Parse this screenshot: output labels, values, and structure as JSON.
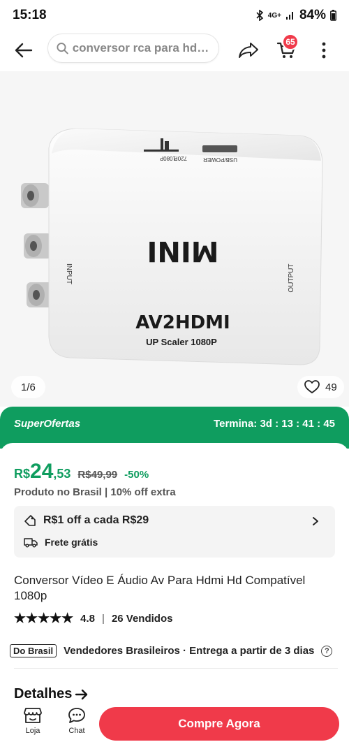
{
  "status": {
    "time": "15:18",
    "network": "4G+",
    "battery": "84%"
  },
  "header": {
    "search_placeholder": "conversor rca para hdmi...",
    "cart_count": "65",
    "icons": [
      "back-arrow-icon",
      "search-icon",
      "share-icon",
      "cart-icon",
      "more-vertical-icon"
    ]
  },
  "gallery": {
    "counter": "1/6",
    "favorites": "49",
    "device_labels": {
      "brand": "MINI",
      "model": "AV2HDMI",
      "subtitle": "UP Scaler 1080P",
      "input": "INPUT",
      "output": "OUTPUT",
      "port": "USB/POWER",
      "switch_720": "720P",
      "switch_1080": "1080P"
    }
  },
  "offer": {
    "label": "SuperOfertas",
    "timer": "Termina: 3d : 13 : 41 : 45"
  },
  "price": {
    "currency": "R$",
    "integer": "24",
    "decimal": ",53",
    "old": "R$49,99",
    "discount": "-50%",
    "origin": "Produto no Brasil | 10% off extra"
  },
  "promo": {
    "coupon": "R$1 off a cada R$29",
    "shipping": "Frete grátis"
  },
  "product": {
    "title": "Conversor Vídeo E Áudio Av Para Hdmi Hd Compatível 1080p",
    "rating": "4.8",
    "sold": "26 Vendidos",
    "stars": "★★★★★"
  },
  "seller": {
    "tag": "Do Brasil",
    "text": "Vendedores Brasileiros · Entrega a partir de 3 dias"
  },
  "details": {
    "label": "Detalhes"
  },
  "bottom": {
    "store_label": "Loja",
    "chat_label": "Chat",
    "buy_label": "Compre Agora"
  },
  "colors": {
    "accent_green": "#0f9d5f",
    "buy_red": "#f03a4a"
  }
}
